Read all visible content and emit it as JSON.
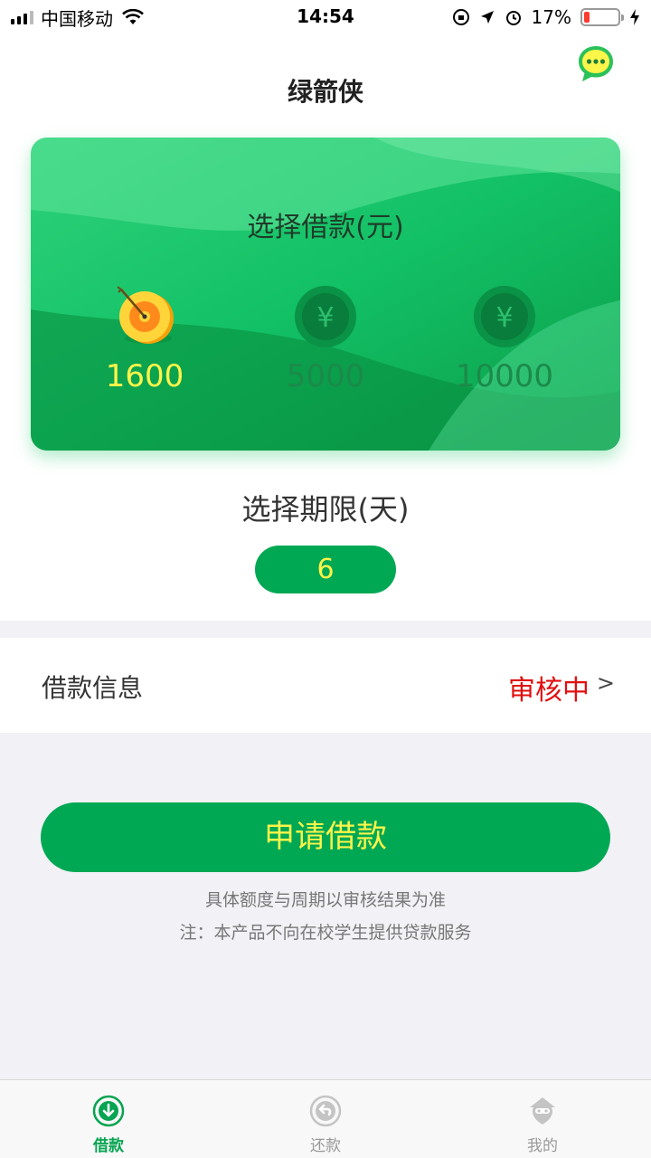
{
  "status_bar": {
    "carrier": "中国移动",
    "time": "14:54",
    "battery": "17%",
    "battery_level": 0.17
  },
  "header": {
    "title": "绿箭侠",
    "chat_icon": "chat-bubble-icon"
  },
  "amount_card": {
    "title": "选择借款(元)",
    "options": [
      {
        "value": "1600",
        "icon": "target-coin-icon",
        "selected": true
      },
      {
        "value": "5000",
        "icon": "yen-coin-icon",
        "selected": false
      },
      {
        "value": "10000",
        "icon": "yen-coin-icon",
        "selected": false
      }
    ]
  },
  "term": {
    "title": "选择期限(天)",
    "value": "6"
  },
  "loan_info": {
    "label": "借款信息",
    "status": "审核中",
    "arrow": ">"
  },
  "apply": {
    "button": "申请借款",
    "note1": "具体额度与周期以审核结果为准",
    "note2": "注：本产品不向在校学生提供贷款服务"
  },
  "tabs": [
    {
      "label": "借款",
      "icon": "borrow-icon",
      "active": true
    },
    {
      "label": "还款",
      "icon": "repay-icon",
      "active": false
    },
    {
      "label": "我的",
      "icon": "profile-icon",
      "active": false
    }
  ],
  "colors": {
    "primary_green": "#01a854",
    "highlight_yellow": "#fcf54a",
    "status_red": "#e01010"
  }
}
